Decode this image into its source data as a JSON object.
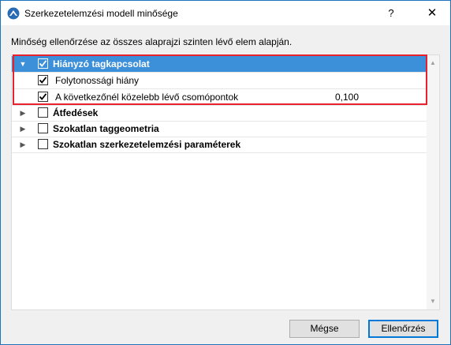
{
  "window": {
    "title": "Szerkezetelemzési modell minősége",
    "help_label": "?",
    "close_label": "✕"
  },
  "description": "Minőség ellenőrzése az összes alaprajzi szinten lévő elem alapján.",
  "tree": {
    "items": [
      {
        "label": "Hiányzó tagkapcsolat",
        "checked": true,
        "expanded": true,
        "selected": true,
        "bold": true
      },
      {
        "label": "Folytonossági hiány",
        "checked": true,
        "child": true
      },
      {
        "label": "A következőnél közelebb lévő csomópontok",
        "checked": true,
        "child": true,
        "value": "0,100"
      },
      {
        "label": "Átfedések",
        "checked": false,
        "expanded": false,
        "bold": true
      },
      {
        "label": "Szokatlan taggeometria",
        "checked": false,
        "expanded": false,
        "bold": true
      },
      {
        "label": "Szokatlan szerkezetelemzési paraméterek",
        "checked": false,
        "expanded": false,
        "bold": true
      }
    ]
  },
  "buttons": {
    "cancel_label": "Mégse",
    "ok_label": "Ellenőrzés"
  },
  "colors": {
    "selection": "#3c8fd9",
    "highlight_border": "#e8212e",
    "default_button_border": "#0078d7"
  },
  "icons": {
    "app": "archicad-app-icon",
    "expanded": "triangle-down-icon",
    "collapsed": "triangle-right-icon",
    "checkbox": "checkmark-icon"
  }
}
